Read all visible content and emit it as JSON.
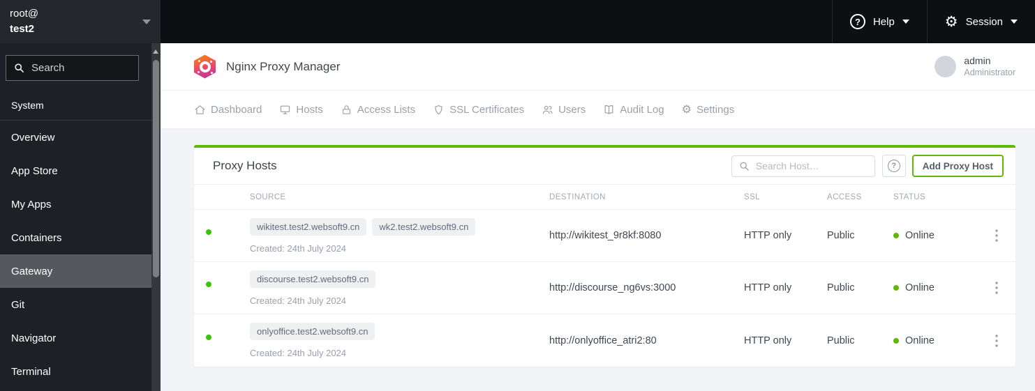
{
  "icons": {
    "question_mark": "?",
    "gear": "⚙"
  },
  "colors": {
    "accent_green": "#5eba00",
    "topbar_bg": "#0d1013",
    "sidebar_bg": "#1d2126",
    "content_bg": "#f3f4f8"
  },
  "host_switcher": {
    "user_line": "root@",
    "host_line": "test2"
  },
  "sidebar": {
    "search_placeholder": "Search",
    "section_label": "System",
    "selected_item": "Gateway",
    "items": [
      {
        "label": "Overview"
      },
      {
        "label": "App Store"
      },
      {
        "label": "My Apps"
      },
      {
        "label": "Containers"
      },
      {
        "label": "Gateway"
      },
      {
        "label": "Git"
      },
      {
        "label": "Navigator"
      },
      {
        "label": "Terminal"
      }
    ]
  },
  "topbar": {
    "help": "Help",
    "session": "Session"
  },
  "app_header": {
    "title": "Nginx Proxy Manager",
    "user": {
      "name": "admin",
      "role": "Administrator"
    }
  },
  "tabs": [
    {
      "label": "Dashboard"
    },
    {
      "label": "Hosts"
    },
    {
      "label": "Access Lists"
    },
    {
      "label": "SSL Certificates"
    },
    {
      "label": "Users"
    },
    {
      "label": "Audit Log"
    },
    {
      "label": "Settings"
    }
  ],
  "proxy_hosts": {
    "title": "Proxy Hosts",
    "search_placeholder": "Search Host…",
    "add_button": "Add Proxy Host",
    "columns": {
      "source": "SOURCE",
      "destination": "DESTINATION",
      "ssl": "SSL",
      "access": "ACCESS",
      "status": "STATUS"
    },
    "rows": [
      {
        "sources": [
          "wikitest.test2.websoft9.cn",
          "wk2.test2.websoft9.cn"
        ],
        "created": "Created: 24th July 2024",
        "destination": "http://wikitest_9r8kf:8080",
        "ssl": "HTTP only",
        "access": "Public",
        "status": "Online"
      },
      {
        "sources": [
          "discourse.test2.websoft9.cn"
        ],
        "created": "Created: 24th July 2024",
        "destination": "http://discourse_ng6vs:3000",
        "ssl": "HTTP only",
        "access": "Public",
        "status": "Online"
      },
      {
        "sources": [
          "onlyoffice.test2.websoft9.cn"
        ],
        "created": "Created: 24th July 2024",
        "destination": "http://onlyoffice_atri2:80",
        "ssl": "HTTP only",
        "access": "Public",
        "status": "Online"
      }
    ]
  }
}
